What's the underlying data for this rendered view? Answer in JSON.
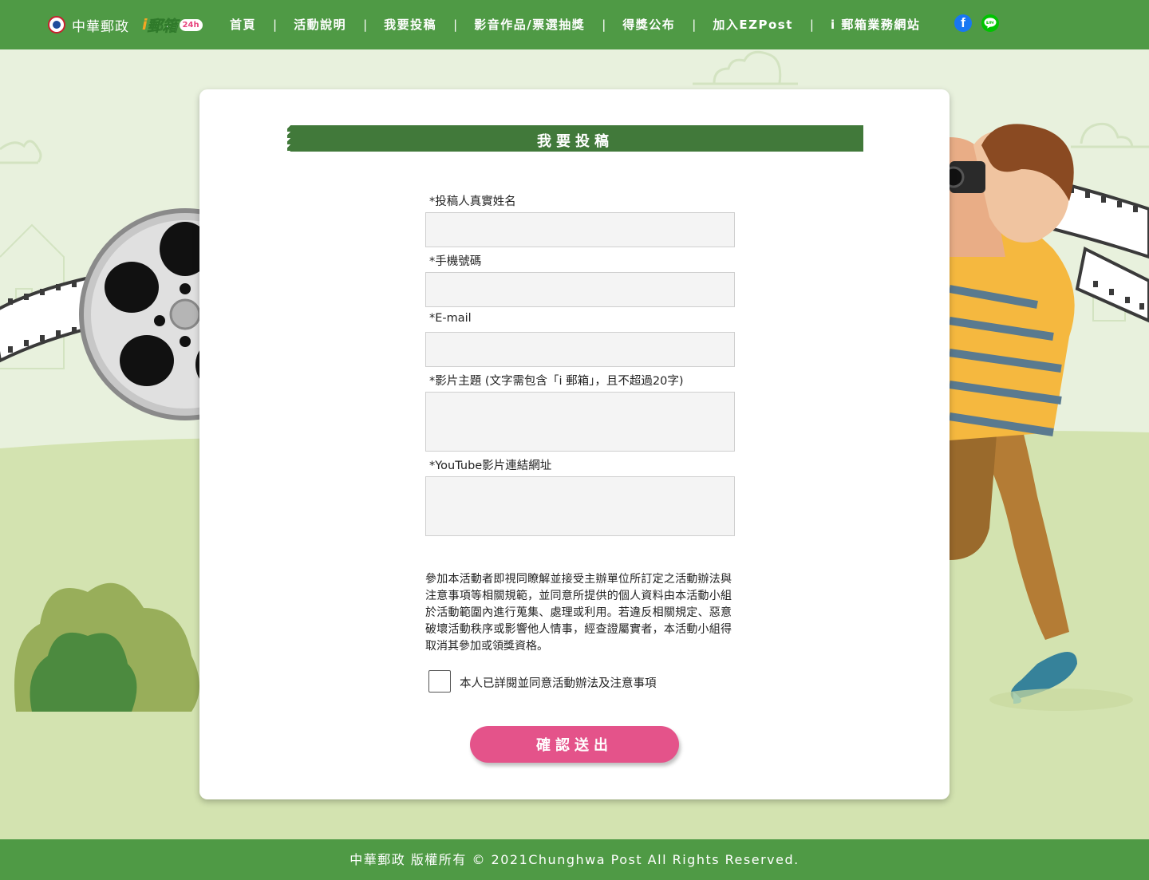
{
  "header": {
    "brand_name": "中華郵政",
    "ibox_logo": {
      "i": "i",
      "word": "郵箱",
      "badge": "24h"
    },
    "nav": [
      {
        "label": "首頁"
      },
      {
        "label": "活動說明"
      },
      {
        "label": "我要投稿"
      },
      {
        "label": "影音作品/票選抽獎"
      },
      {
        "label": "得獎公布"
      },
      {
        "label": "加入EZPost"
      },
      {
        "label": "i 郵箱業務網站"
      }
    ],
    "social": {
      "facebook_icon": "facebook-icon",
      "facebook_glyph": "f",
      "line_icon": "line-icon"
    }
  },
  "form": {
    "title": "我要投稿",
    "fields": [
      {
        "label": "*投稿人真實姓名",
        "value": ""
      },
      {
        "label": "*手機號碼",
        "value": ""
      },
      {
        "label": "*E-mail",
        "value": ""
      },
      {
        "label": "*影片主題 (文字需包含「i 郵箱」，且不超過20字)",
        "value": ""
      },
      {
        "label": "*YouTube影片連結網址",
        "value": ""
      }
    ],
    "notice": "參加本活動者即視同瞭解並接受主辦單位所訂定之活動辦法與注意事項等相關規範，並同意所提供的個人資料由本活動小組於活動範圍內進行蒐集、處理或利用。若違反相關規定、惡意破壞活動秩序或影響他人情事，經查證屬實者，本活動小組得取消其參加或領獎資格。",
    "agree_label": "本人已詳閱並同意活動辦法及注意事項",
    "agree_checked": false,
    "submit_label": "確認送出"
  },
  "footer": {
    "copyright": "中華郵政 版權所有 © 2021Chunghwa Post All Rights Reserved."
  },
  "colors": {
    "header_green": "#4f9a45",
    "title_green": "#41793a",
    "submit_pink": "#e4538a",
    "background": "#e8f1dd"
  }
}
